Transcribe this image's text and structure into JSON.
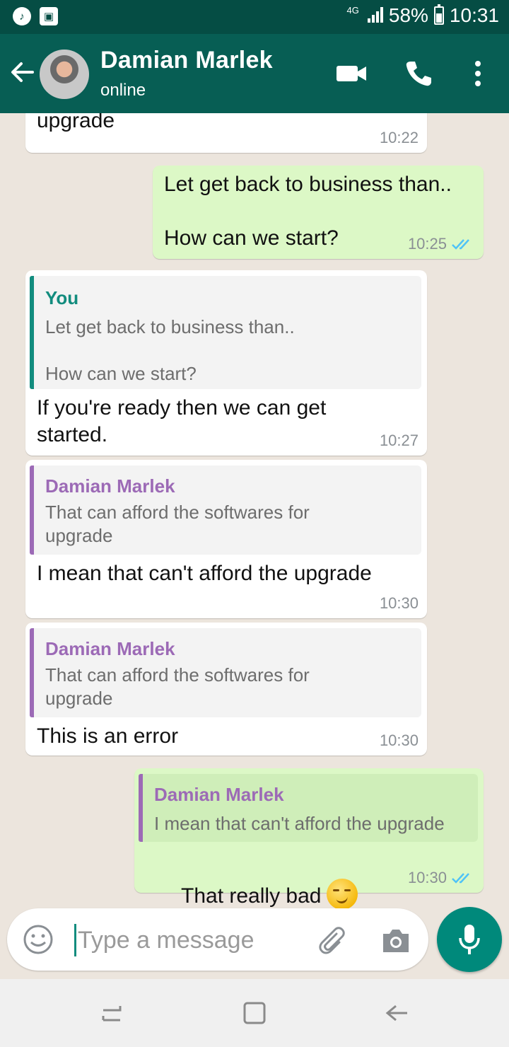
{
  "status_bar": {
    "network": "4G",
    "battery": "58%",
    "time": "10:31"
  },
  "header": {
    "contact_name": "Damian Marlek",
    "contact_status": "online"
  },
  "messages": [
    {
      "type": "incoming",
      "text": "upgrade",
      "time": "10:22"
    },
    {
      "type": "outgoing",
      "text": "Let get back to business than..\n\nHow can we start?",
      "time": "10:25",
      "read": true
    },
    {
      "type": "incoming",
      "quote_name": "You",
      "quote_text": "Let get back to business than..\n\nHow can we start?",
      "text": "If you're ready then we can get\nstarted.",
      "time": "10:27"
    },
    {
      "type": "incoming",
      "quote_name": "Damian Marlek",
      "quote_text": "That can afford the softwares for\nupgrade",
      "text": "I mean that can't afford the upgrade",
      "time": "10:30"
    },
    {
      "type": "incoming",
      "quote_name": "Damian Marlek",
      "quote_text": "That can afford the softwares for\nupgrade",
      "text": "This is an error",
      "time": "10:30"
    },
    {
      "type": "outgoing",
      "quote_name": "Damian Marlek",
      "quote_text": "I mean that can't afford the upgrade",
      "text": "That really bad",
      "emoji": "smirking-face-emoji",
      "time": "10:30",
      "read": true
    }
  ],
  "composer": {
    "placeholder": "Type a message"
  },
  "colors": {
    "header": "#075e54",
    "status_bar": "#054d44",
    "chat_bg": "#ece5dd",
    "outgoing_bubble": "#dcf8c6",
    "quote_you": "#128c7e",
    "quote_contact": "#9c6ab6",
    "read_ticks": "#4fc3f7",
    "mic_button": "#00897b"
  },
  "icons": [
    "music-icon",
    "gallery-icon",
    "back-arrow-icon",
    "video-call-icon",
    "voice-call-icon",
    "more-vert-icon",
    "emoji-icon",
    "attach-icon",
    "camera-icon",
    "mic-icon",
    "recent-apps-icon",
    "home-icon",
    "back-nav-icon"
  ]
}
